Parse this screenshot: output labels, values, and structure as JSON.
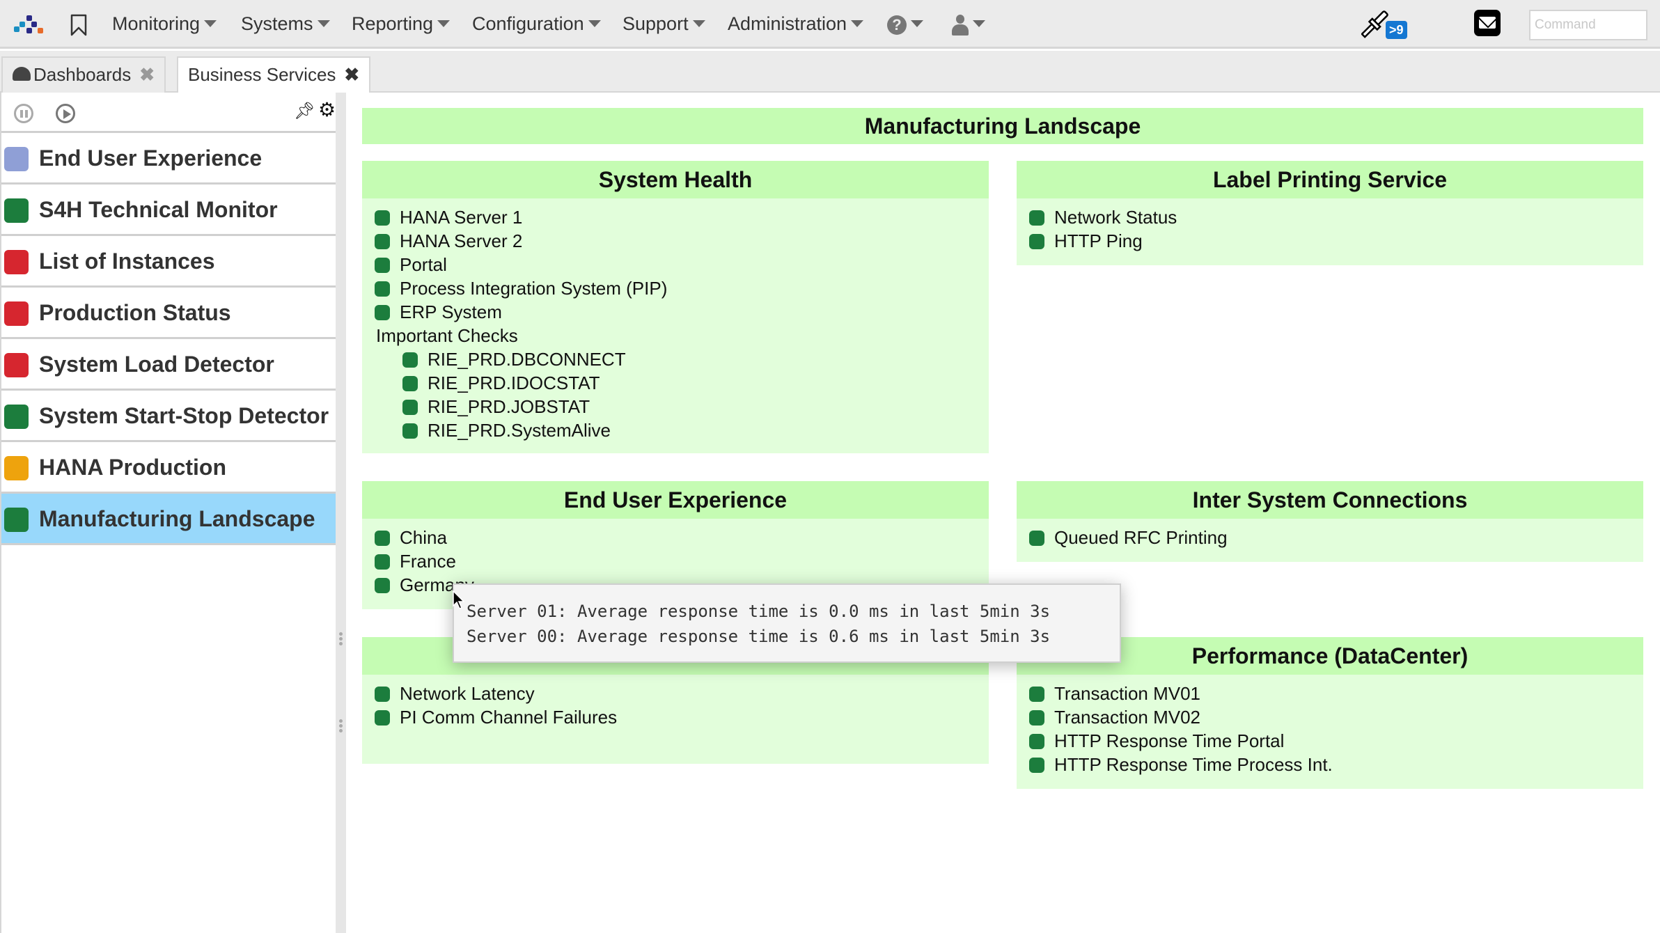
{
  "topbar": {
    "nav": [
      "Monitoring",
      "Systems",
      "Reporting",
      "Configuration",
      "Support",
      "Administration"
    ],
    "help_icon": "question-circle-icon",
    "user_icon": "user-icon",
    "notifications_badge": ">9",
    "command_placeholder": "Command",
    "command_value": ""
  },
  "tabs": [
    {
      "label": "Dashboards",
      "icon": "dashboard-gauge-icon",
      "active": false
    },
    {
      "label": "Business Services",
      "active": true
    }
  ],
  "sidebar": {
    "items": [
      {
        "label": "End User Experience",
        "status_color": "#8f9fd6",
        "selected": false
      },
      {
        "label": "S4H Technical Monitor",
        "status_color": "#1c7d3d",
        "selected": false
      },
      {
        "label": "List of Instances",
        "status_color": "#d6262f",
        "selected": false
      },
      {
        "label": "Production Status",
        "status_color": "#d6262f",
        "selected": false
      },
      {
        "label": "System Load Detector",
        "status_color": "#d6262f",
        "selected": false
      },
      {
        "label": "System Start-Stop Detector",
        "status_color": "#1c7d3d",
        "selected": false
      },
      {
        "label": "HANA Production",
        "status_color": "#eea30d",
        "selected": false
      },
      {
        "label": "Manufacturing Landscape",
        "status_color": "#1c7d3d",
        "selected": true
      }
    ]
  },
  "main": {
    "title": "Manufacturing Landscape",
    "cards": {
      "system_health": {
        "title": "System Health",
        "items": [
          "HANA Server 1",
          "HANA Server 2",
          "Portal",
          "Process Integration System (PIP)",
          "ERP System"
        ],
        "group_label": "Important Checks",
        "group_items": [
          "RIE_PRD.DBCONNECT",
          "RIE_PRD.IDOCSTAT",
          "RIE_PRD.JOBSTAT",
          "RIE_PRD.SystemAlive"
        ]
      },
      "label_printing": {
        "title": "Label Printing Service",
        "items": [
          "Network Status",
          "HTTP Ping"
        ]
      },
      "end_user_experience": {
        "title": "End User Experience",
        "items": [
          "China",
          "France",
          "Germany"
        ]
      },
      "inter_system": {
        "title": "Inter System Connections",
        "items": [
          "Queued RFC Printing"
        ]
      },
      "network_card": {
        "title": "",
        "items": [
          "Network Latency",
          "PI Comm Channel Failures"
        ]
      },
      "performance": {
        "title": "Performance (DataCenter)",
        "items": [
          "Transaction MV01",
          "Transaction MV02",
          "HTTP Response Time Portal",
          "HTTP Response Time Process Int."
        ]
      }
    },
    "status_color_ok": "#1c7d3d"
  },
  "tooltip": {
    "lines": [
      "Server 01: Average response time is 0.0 ms in last 5min 3s",
      "Server 00: Average response time is 0.6 ms in last 5min 3s"
    ]
  }
}
